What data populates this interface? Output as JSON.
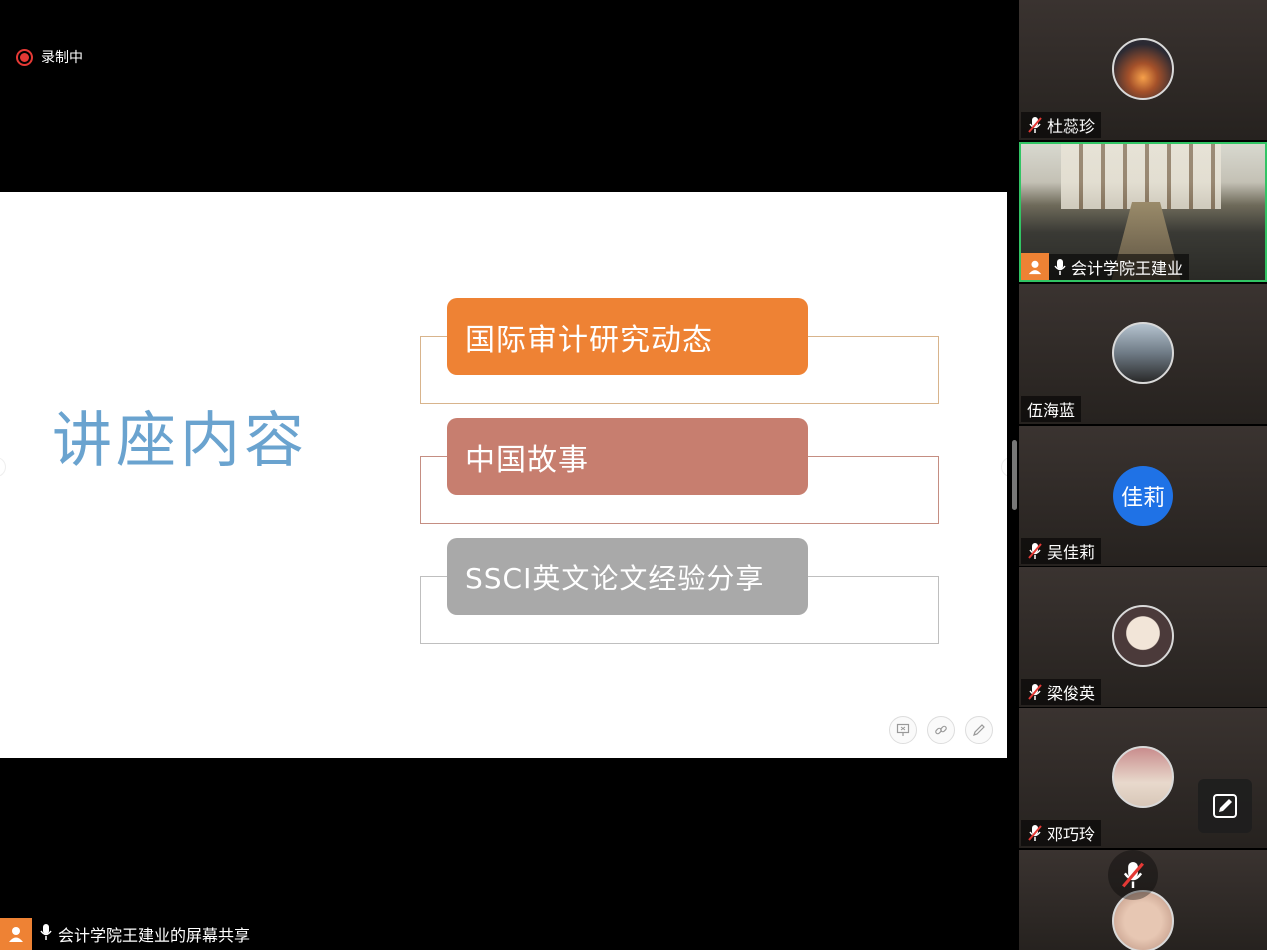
{
  "recording": {
    "label": "录制中"
  },
  "slide": {
    "title": "讲座内容",
    "items": [
      {
        "label": "国际审计研究动态",
        "color": "#ee8234"
      },
      {
        "label": "中国故事",
        "color": "#c77e6f"
      },
      {
        "label": "SSCI英文论文经验分享",
        "color": "#a9a9a9"
      }
    ],
    "title_color": "#6aa3cf"
  },
  "share": {
    "label": "会计学院王建业的屏幕共享"
  },
  "participants": [
    {
      "name": "杜蕊珍",
      "muted": true
    },
    {
      "name": "会计学院王建业",
      "muted": false,
      "active": true
    },
    {
      "name": "伍海蓝",
      "muted": false
    },
    {
      "name": "吴佳莉",
      "avatar_text": "佳莉",
      "muted": true
    },
    {
      "name": "梁俊英",
      "muted": true
    },
    {
      "name": "邓巧玲",
      "muted": true
    },
    {
      "name": "",
      "muted": true
    }
  ],
  "colors": {
    "active_border": "#31c464",
    "recording": "#e53935",
    "host_orange": "#ee8234"
  }
}
